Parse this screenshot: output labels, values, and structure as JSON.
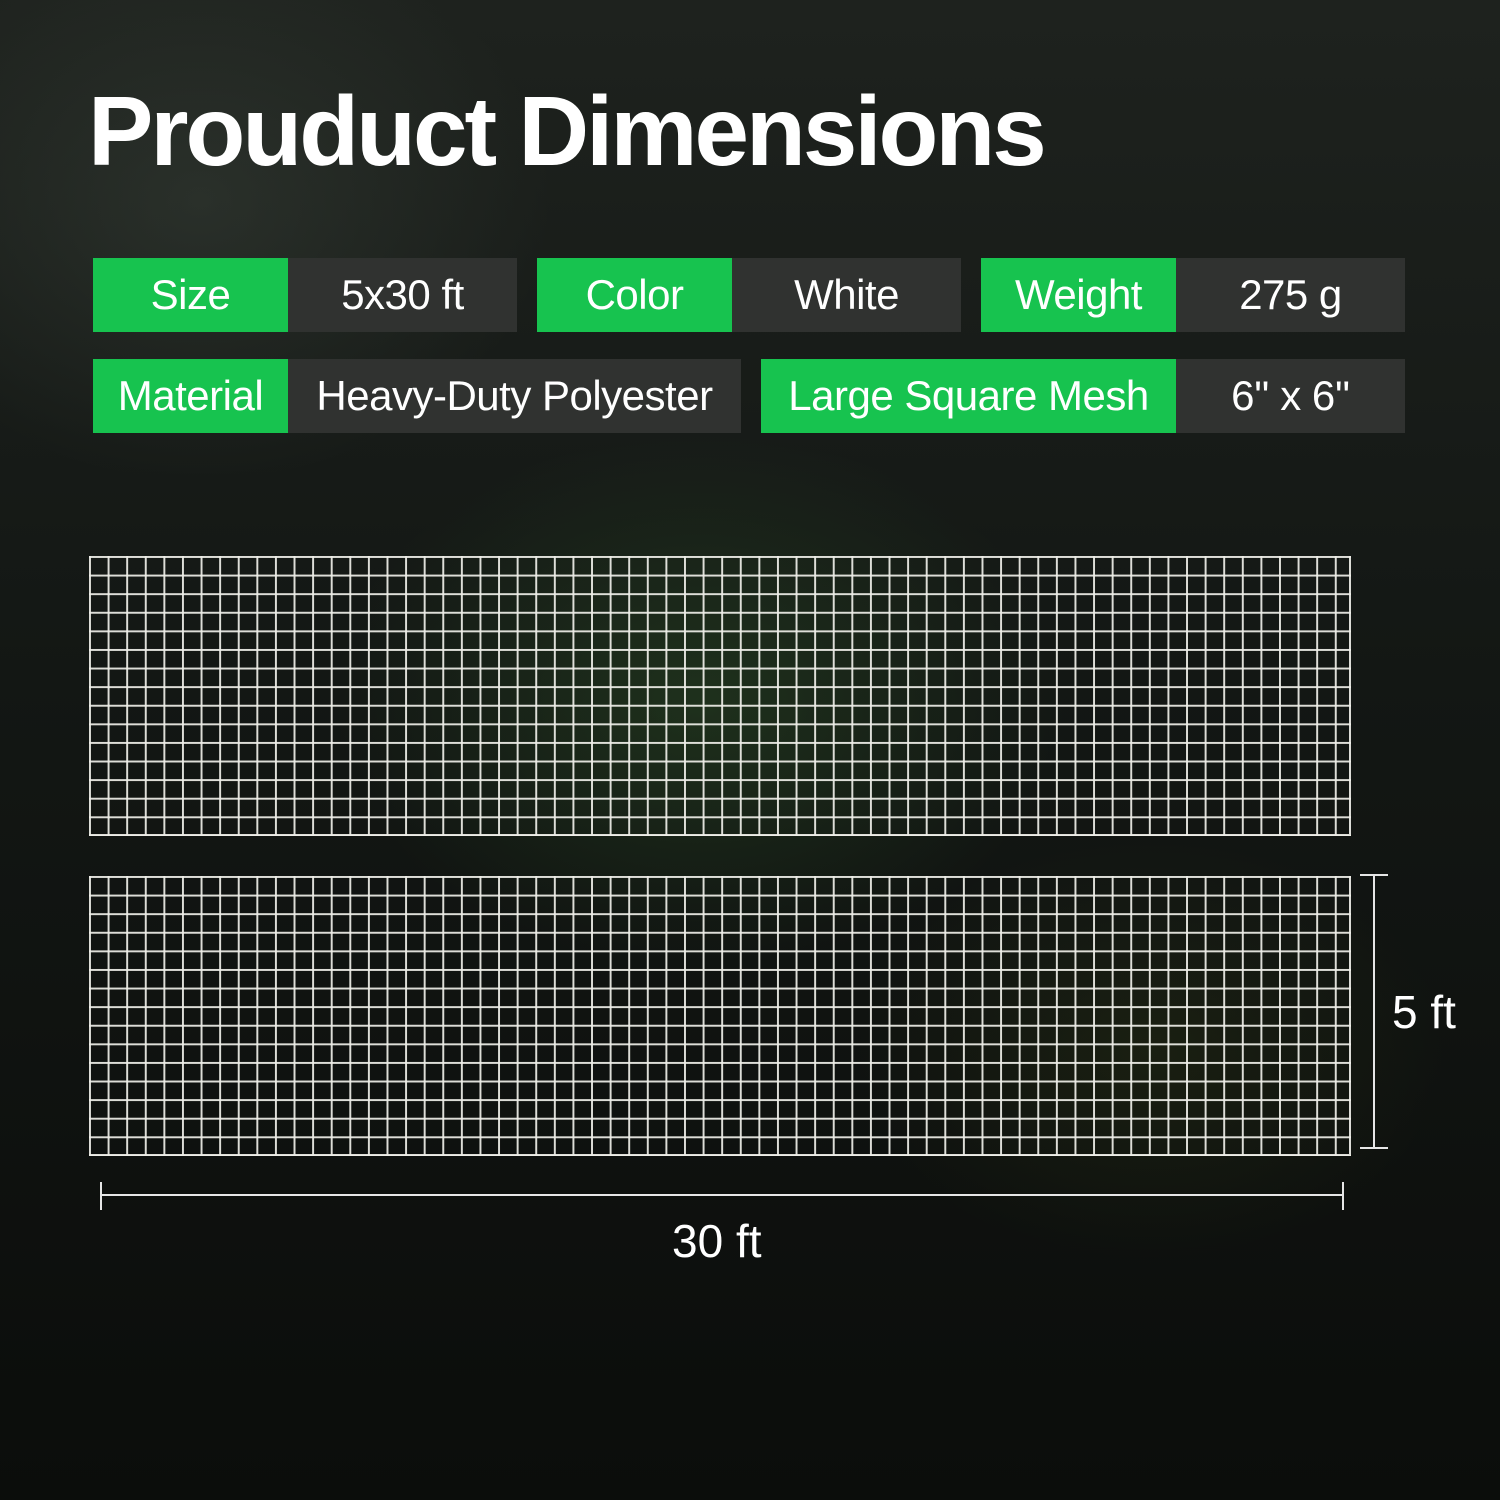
{
  "title": "Prouduct Dimensions",
  "specs": {
    "size": {
      "label": "Size",
      "value": "5x30 ft"
    },
    "color": {
      "label": "Color",
      "value": "White"
    },
    "weight": {
      "label": "Weight",
      "value": "275 g"
    },
    "material": {
      "label": "Material",
      "value": "Heavy-Duty Polyester"
    },
    "mesh": {
      "label": "Large Square Mesh",
      "value": "6'' x 6''"
    }
  },
  "dimensions": {
    "width_label": "30 ft",
    "height_label": "5 ft"
  },
  "colors": {
    "accent": "#17c34f",
    "value_bg": "#303230",
    "background": "#131714"
  }
}
